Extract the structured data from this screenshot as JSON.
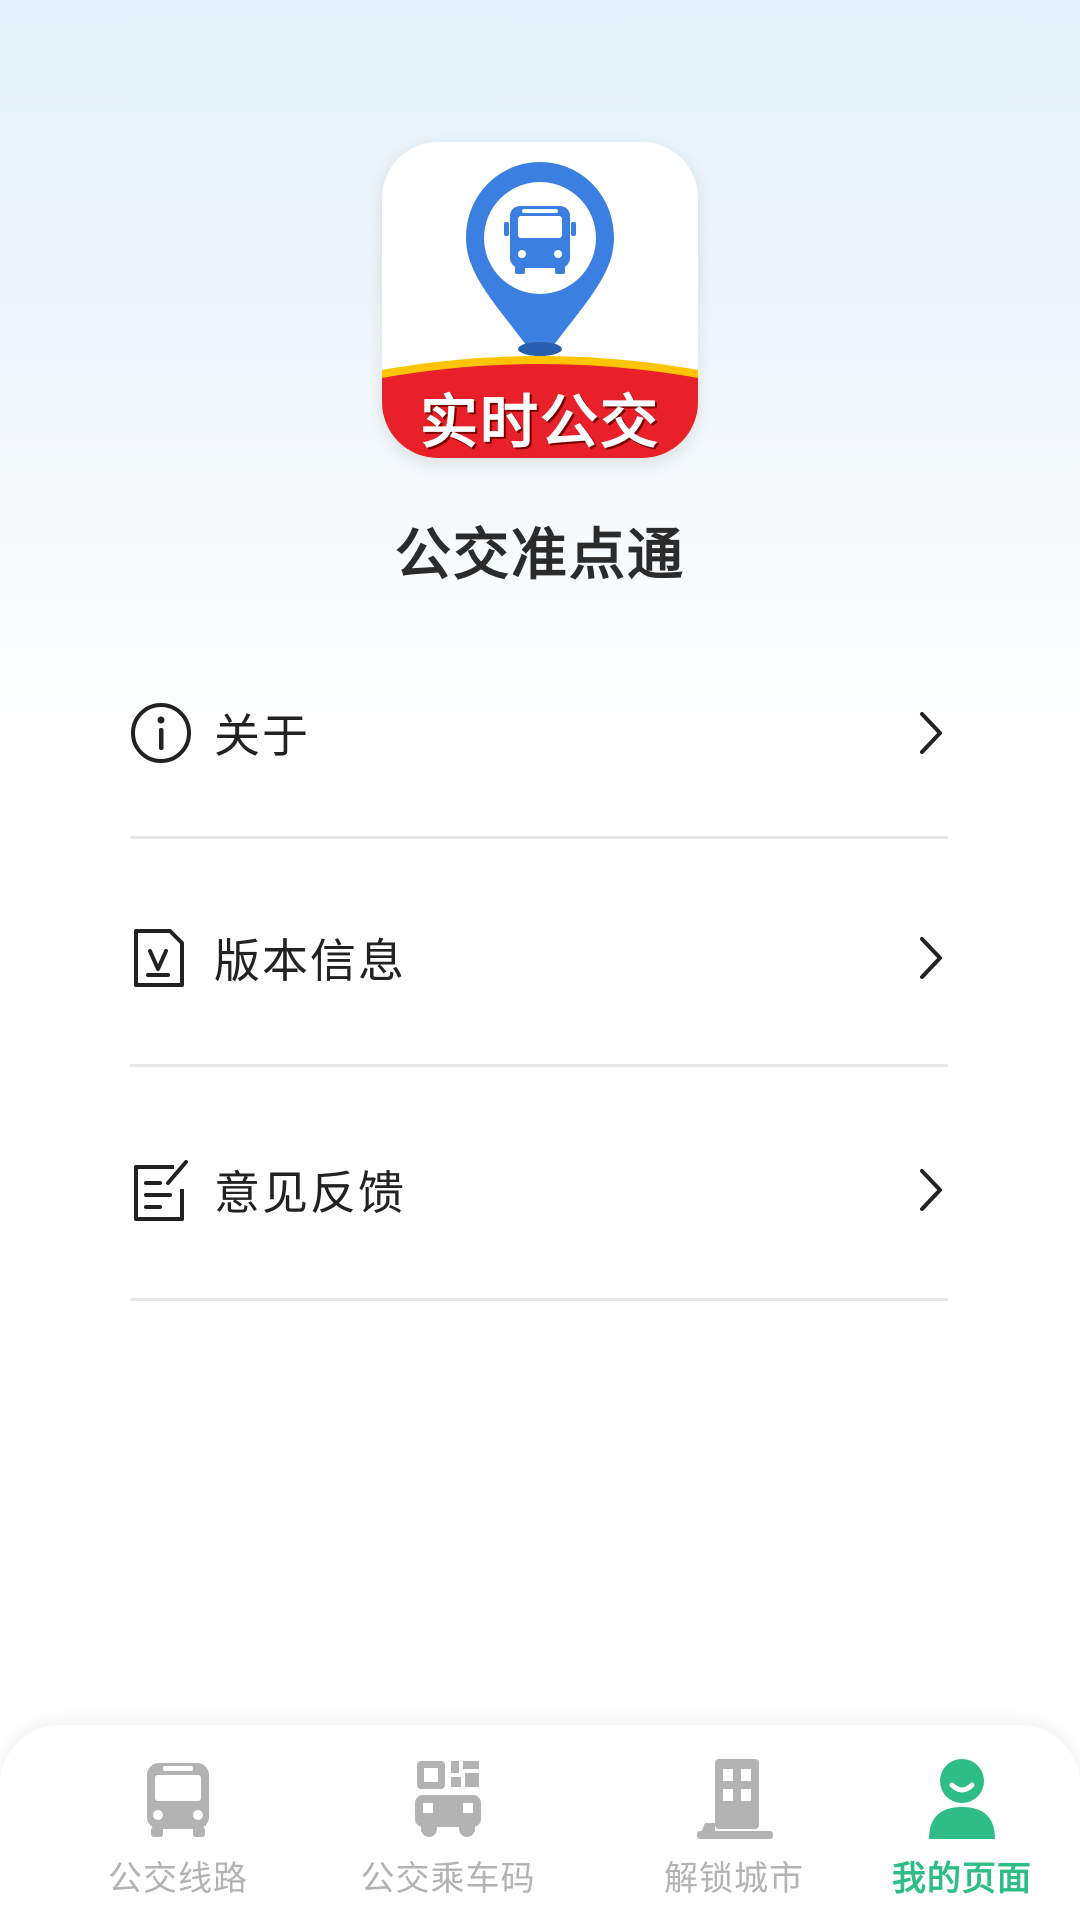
{
  "app": {
    "logo_banner_text": "实时公交",
    "name": "公交准点通"
  },
  "menu": {
    "items": [
      {
        "label": "关于",
        "icon": "info-icon"
      },
      {
        "label": "版本信息",
        "icon": "version-document-icon"
      },
      {
        "label": "意见反馈",
        "icon": "feedback-edit-icon"
      }
    ]
  },
  "tabbar": {
    "tabs": [
      {
        "label": "公交线路",
        "icon": "bus-icon",
        "active": false
      },
      {
        "label": "公交乘车码",
        "icon": "qr-bus-code-icon",
        "active": false
      },
      {
        "label": "解锁城市",
        "icon": "city-building-icon",
        "active": false
      },
      {
        "label": "我的页面",
        "icon": "user-profile-icon",
        "active": true
      }
    ]
  },
  "colors": {
    "accent_green": "#2ebd85",
    "inactive_gray": "#b3b3b3",
    "logo_blue": "#3b7fe0",
    "logo_red": "#e8202a",
    "logo_yellow": "#ffc400"
  }
}
